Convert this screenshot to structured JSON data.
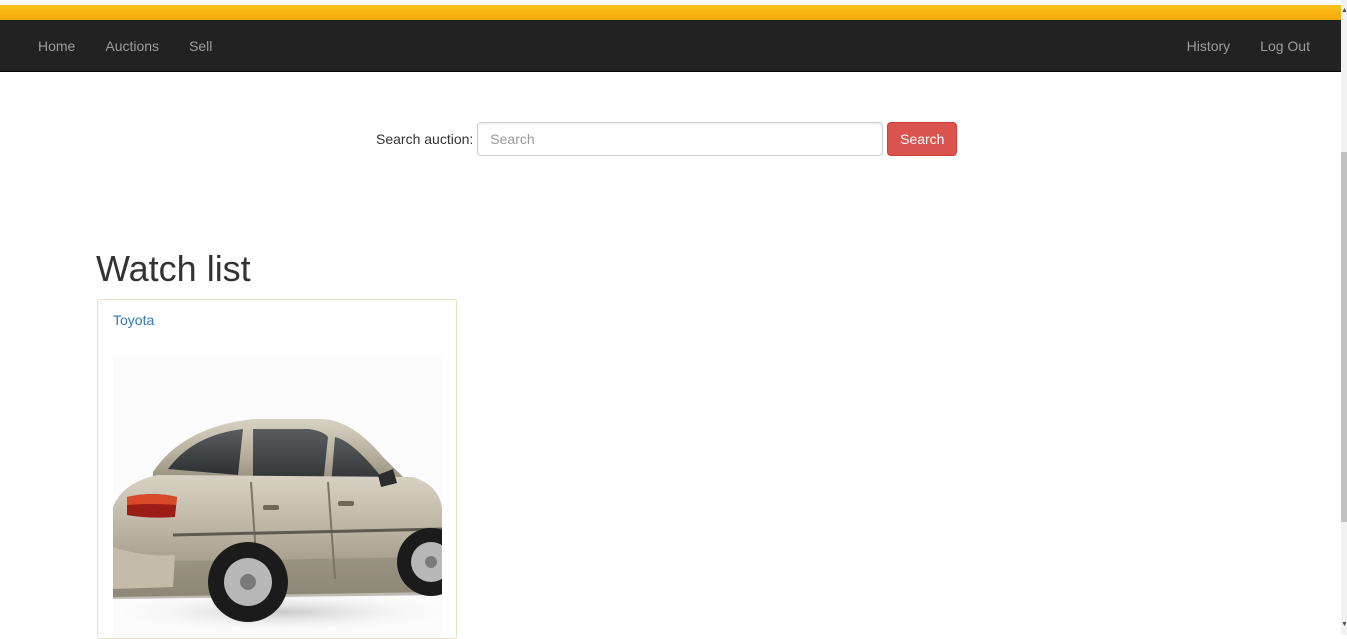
{
  "nav": {
    "left": [
      "Home",
      "Auctions",
      "Sell"
    ],
    "right": [
      "History",
      "Log Out"
    ]
  },
  "search": {
    "label": "Search auction:",
    "placeholder": "Search",
    "button": "Search"
  },
  "watchlist": {
    "heading": "Watch list",
    "items": [
      {
        "title": "Toyota",
        "image": "car-photo"
      }
    ]
  },
  "colors": {
    "navbar": "#222222",
    "nav_text": "#9d9d9d",
    "gold": "#f5a70c",
    "danger": "#d9534f",
    "link": "#337ab7"
  }
}
